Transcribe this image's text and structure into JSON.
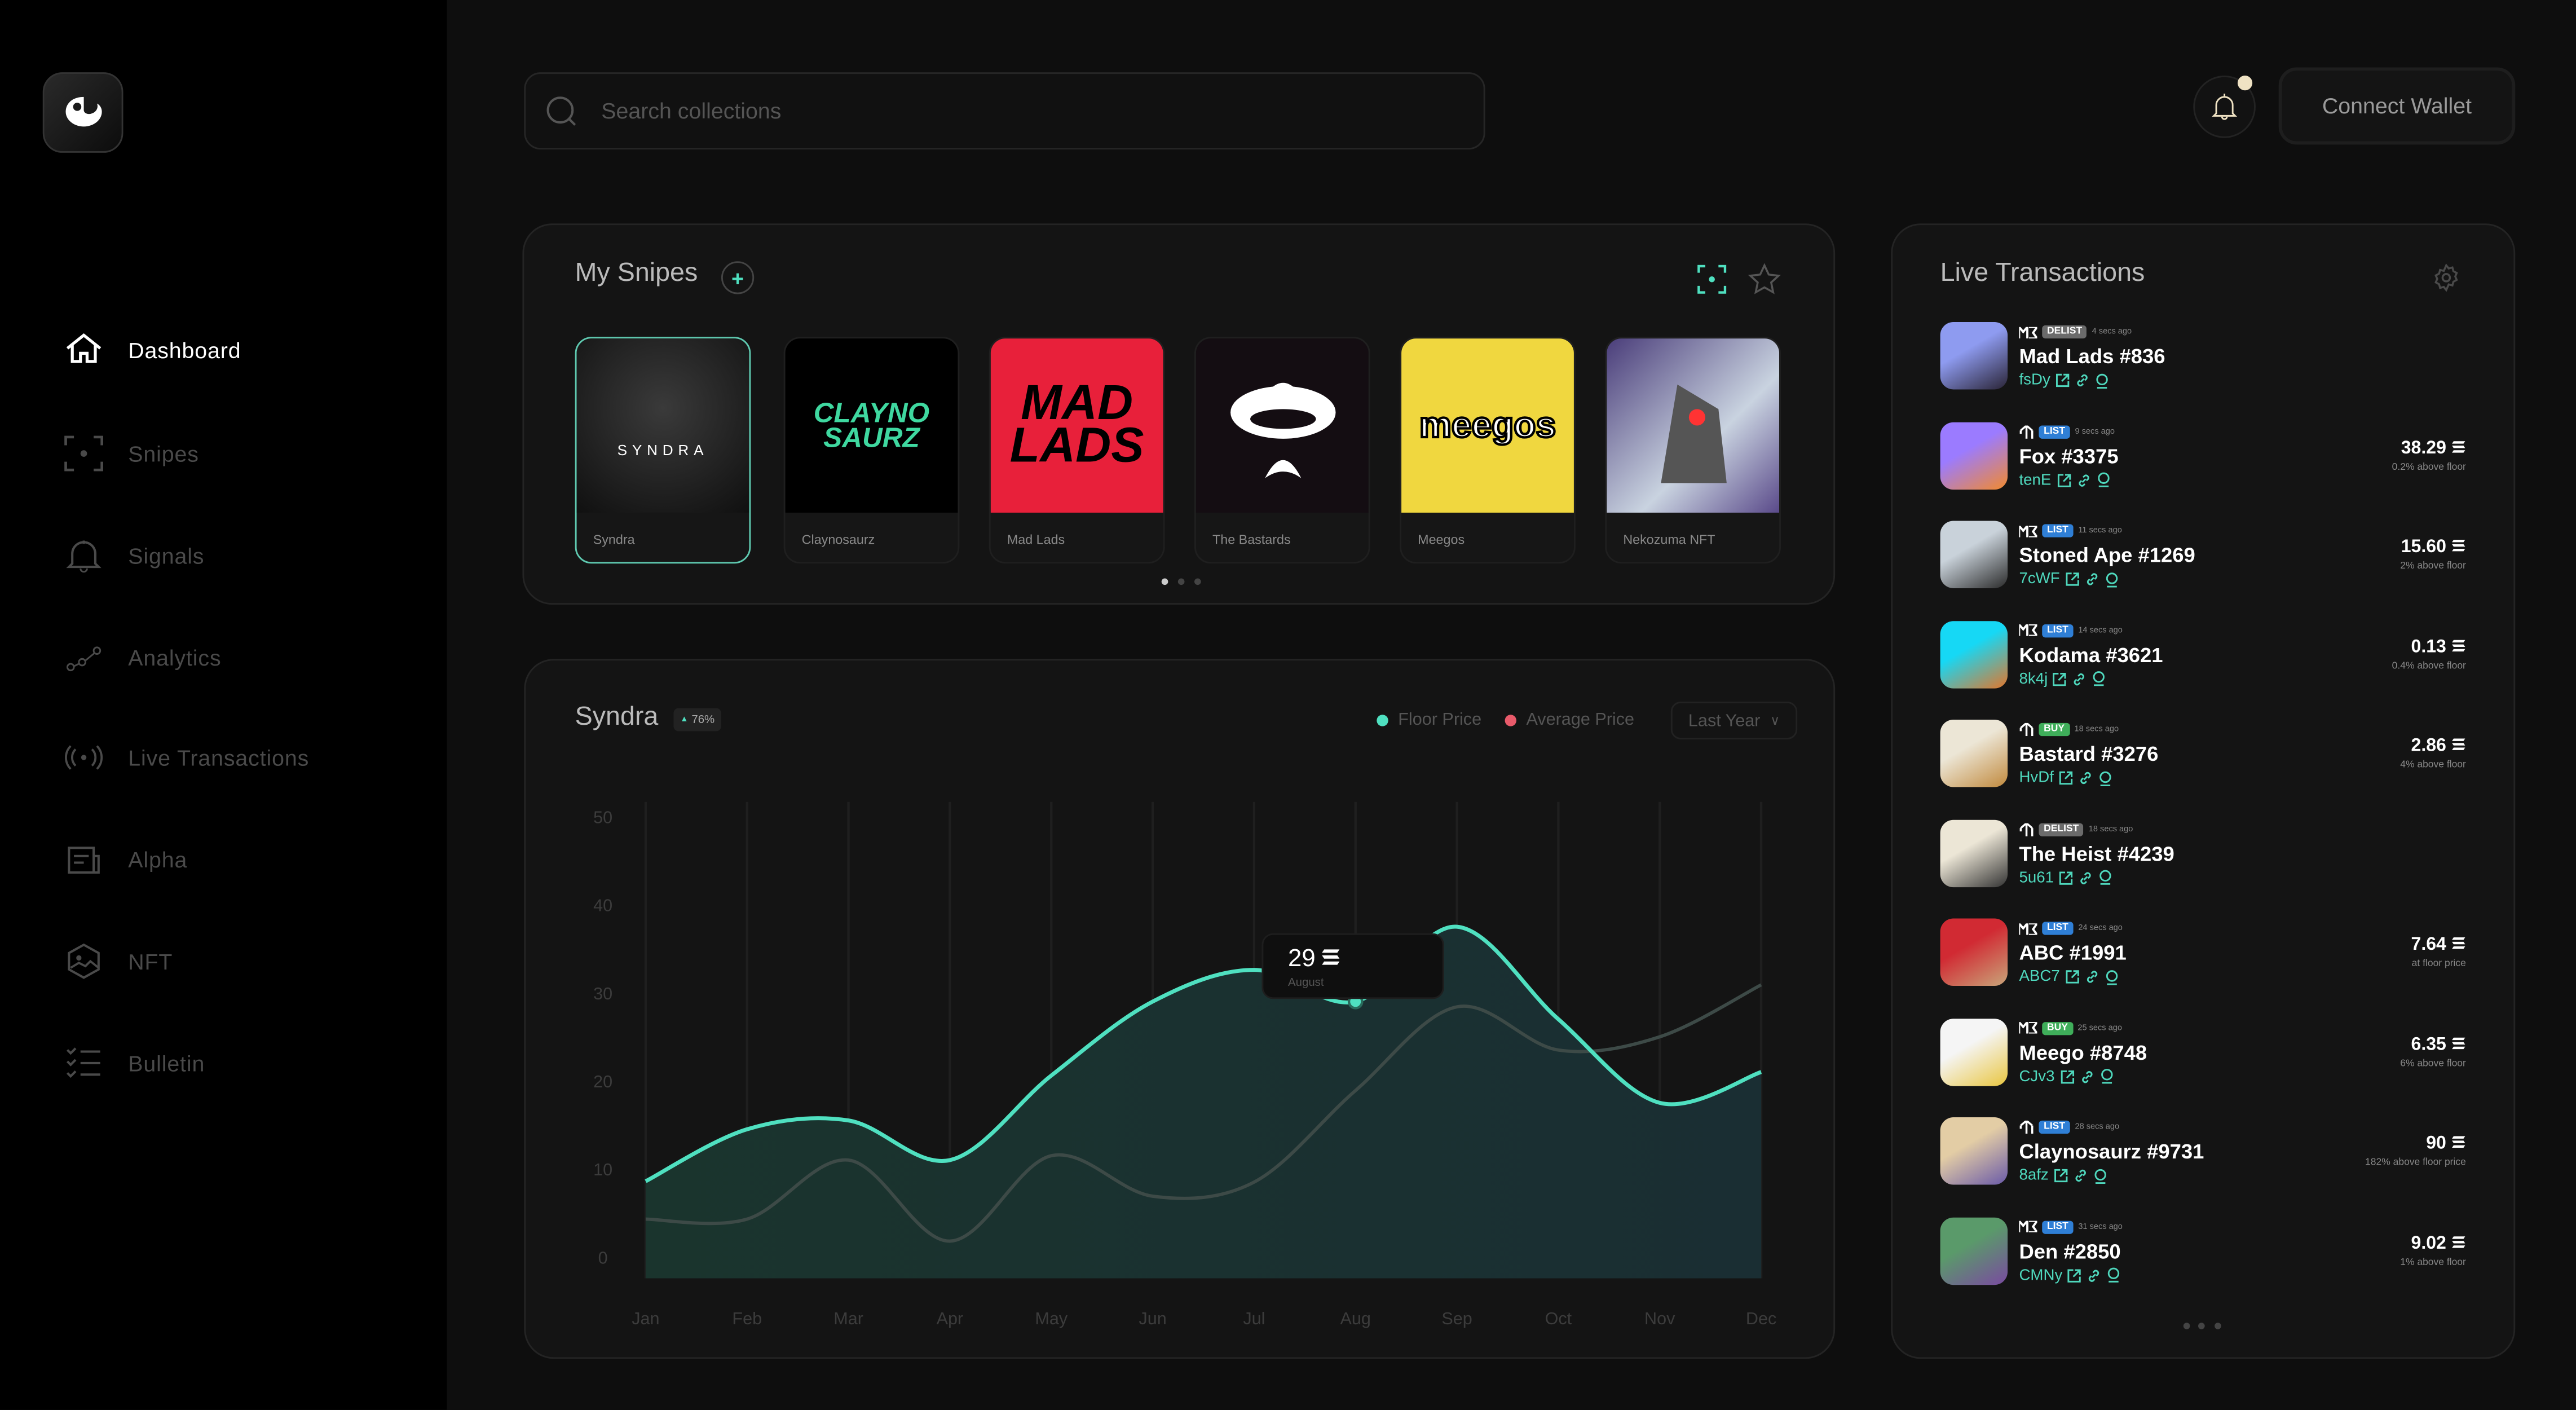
{
  "brand": {
    "logo_icon": "syndra-logo-icon"
  },
  "sidebar": {
    "items": [
      {
        "label": "Dashboard",
        "icon": "home-icon",
        "active": true
      },
      {
        "label": "Snipes",
        "icon": "scan-target-icon"
      },
      {
        "label": "Signals",
        "icon": "bell-icon"
      },
      {
        "label": "Analytics",
        "icon": "analytics-line-icon"
      },
      {
        "label": "Live Transactions",
        "icon": "broadcast-icon"
      },
      {
        "label": "Alpha",
        "icon": "newspaper-icon"
      },
      {
        "label": "NFT",
        "icon": "nft-image-icon"
      },
      {
        "label": "Bulletin",
        "icon": "checklist-icon"
      }
    ]
  },
  "header": {
    "search_placeholder": "Search collections",
    "connect_wallet": "Connect Wallet",
    "notification_dot_color": "#efe2c3"
  },
  "snipes": {
    "title": "My Snipes",
    "cards": [
      {
        "name": "Syndra",
        "selected": true,
        "logo_text": "SYNDRA"
      },
      {
        "name": "Claynosaurz",
        "logo_text": "CLAYNO SAURZ"
      },
      {
        "name": "Mad Lads",
        "logo_text": "MAD LADS"
      },
      {
        "name": "The Bastards"
      },
      {
        "name": "Meegos",
        "logo_text": "meegos"
      },
      {
        "name": "Nekozuma NFT"
      }
    ],
    "page": 1,
    "pages": 3
  },
  "chart": {
    "title": "Syndra",
    "change": "76%",
    "legend": [
      "Floor Price",
      "Average Price"
    ],
    "range": "Last Year",
    "tooltip": {
      "value": "29",
      "label": "August"
    }
  },
  "chart_data": {
    "type": "area",
    "x": [
      "Jan",
      "Feb",
      "Mar",
      "Apr",
      "May",
      "Jun",
      "Jul",
      "Aug",
      "Sep",
      "Oct",
      "Nov",
      "Dec"
    ],
    "yticks": [
      0,
      10,
      20,
      30,
      40,
      50
    ],
    "ylim": [
      0,
      50
    ],
    "grid": "vertical",
    "series": [
      {
        "name": "Floor Price",
        "color": "#4fe0c0",
        "values": [
          8.6,
          14.5,
          15.5,
          11,
          20.6,
          29,
          32.6,
          29,
          37.5,
          27,
          17.5,
          21
        ]
      },
      {
        "name": "Average Price",
        "color": "#e85a6a",
        "line_color": "#3d4a47",
        "values": [
          4.3,
          4.3,
          11,
          1.8,
          11.5,
          6.9,
          8.5,
          18.9,
          28.4,
          23.5,
          25,
          30.9
        ]
      }
    ],
    "highlight": {
      "x": "Aug",
      "value": 29
    }
  },
  "live": {
    "title": "Live Transactions",
    "pages": 3,
    "rows": [
      {
        "market": "ME",
        "type": "DELIST",
        "time": "4 secs ago",
        "name": "Mad Lads #836",
        "addr": "fsDy",
        "price": "",
        "note": "",
        "colors": [
          "#8e9bf0",
          "#2a2436"
        ]
      },
      {
        "market": "T",
        "type": "LIST",
        "time": "9 secs ago",
        "name": "Fox #3375",
        "addr": "tenE",
        "price": "38.29",
        "note": "0.2% above floor",
        "colors": [
          "#9b7bff",
          "#f28a2e"
        ]
      },
      {
        "market": "ME",
        "type": "LIST",
        "time": "11 secs ago",
        "name": "Stoned Ape #1269",
        "addr": "7cWF",
        "price": "15.60",
        "note": "2% above floor",
        "colors": [
          "#c9d2da",
          "#2b2b2b"
        ]
      },
      {
        "market": "ME",
        "type": "LIST",
        "time": "14 secs ago",
        "name": "Kodama #3621",
        "addr": "8k4j",
        "price": "0.13",
        "note": "0.4% above floor",
        "colors": [
          "#16d8f5",
          "#e2762b"
        ]
      },
      {
        "market": "T",
        "type": "BUY",
        "time": "18 secs ago",
        "name": "Bastard #3276",
        "addr": "HvDf",
        "price": "2.86",
        "note": "4% above floor",
        "colors": [
          "#ece6d6",
          "#c18a3e"
        ]
      },
      {
        "market": "T",
        "type": "DELIST",
        "time": "18 secs ago",
        "name": "The Heist #4239",
        "addr": "5u61",
        "price": "",
        "note": "",
        "colors": [
          "#ece6d6",
          "#333"
        ]
      },
      {
        "market": "ME",
        "type": "LIST",
        "time": "24 secs ago",
        "name": "ABC #1991",
        "addr": "ABC7",
        "price": "7.64",
        "note": "at floor price",
        "colors": [
          "#d12a33",
          "#c9a57a"
        ]
      },
      {
        "market": "ME",
        "type": "BUY",
        "time": "25 secs ago",
        "name": "Meego #8748",
        "addr": "CJv3",
        "price": "6.35",
        "note": "6% above floor",
        "colors": [
          "#f5f5f5",
          "#e9c640"
        ]
      },
      {
        "market": "T",
        "type": "LIST",
        "time": "28 secs ago",
        "name": "Claynosaurz #9731",
        "addr": "8afz",
        "price": "90",
        "note": "182% above floor price",
        "colors": [
          "#e3cda5",
          "#6a5aa8"
        ]
      },
      {
        "market": "ME",
        "type": "LIST",
        "time": "31 secs ago",
        "name": "Den #2850",
        "addr": "CMNy",
        "price": "9.02",
        "note": "1% above floor",
        "colors": [
          "#5a9a6a",
          "#7a4aa0"
        ]
      }
    ]
  },
  "colors": {
    "accent": "#4fe0c0",
    "list": "#2f7fd6",
    "buy": "#3fae5a",
    "delist": "#6b6b6b"
  }
}
